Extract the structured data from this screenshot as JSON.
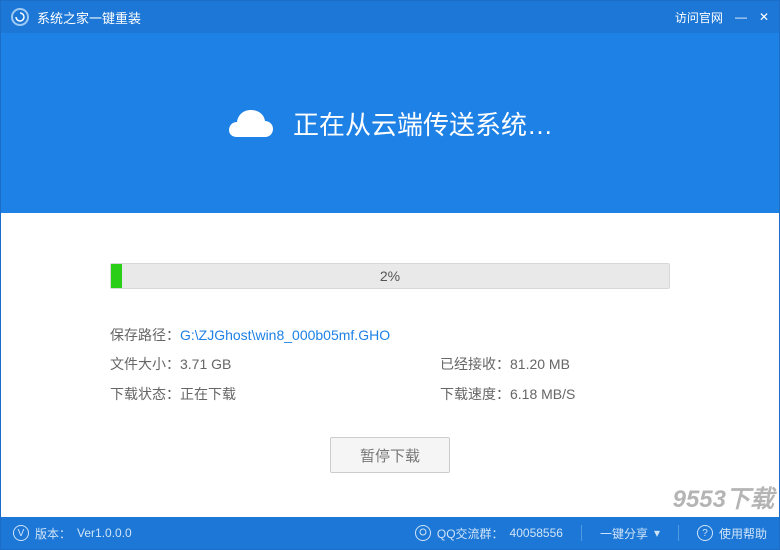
{
  "titlebar": {
    "title": "系统之家一键重装",
    "visit_site": "访问官网"
  },
  "hero": {
    "message": "正在从云端传送系统…"
  },
  "progress": {
    "percent_text": "2%",
    "percent_value": 2
  },
  "info": {
    "save_path_label": "保存路径：",
    "save_path_value": "G:\\ZJGhost\\win8_000b05mf.GHO",
    "file_size_label": "文件大小：",
    "file_size_value": "3.71 GB",
    "received_label": "已经接收：",
    "received_value": "81.20 MB",
    "download_status_label": "下载状态：",
    "download_status_value": "正在下载",
    "download_speed_label": "下载速度：",
    "download_speed_value": "6.18 MB/S"
  },
  "buttons": {
    "pause": "暂停下载"
  },
  "statusbar": {
    "version_label": "版本：",
    "version_value": "Ver1.0.0.0",
    "qq_label": "QQ交流群：",
    "qq_value": "40058556",
    "share_label": "一键分享",
    "help_label": "使用帮助"
  },
  "watermark": "9553下载",
  "colors": {
    "primary": "#1e81e6",
    "titlebar": "#1d77d6",
    "progress_fill": "#2bce17"
  }
}
